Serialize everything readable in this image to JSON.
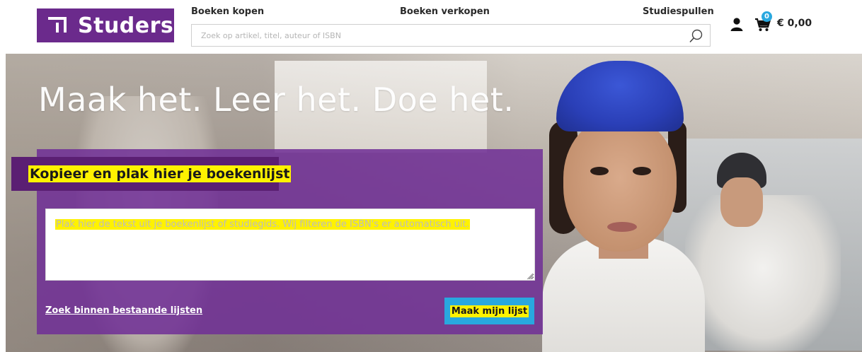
{
  "header": {
    "logo_text": "Studers",
    "nav": {
      "buy_books": "Boeken kopen",
      "sell_books": "Boeken verkopen",
      "study_supplies": "Studiespullen"
    },
    "search": {
      "placeholder": "Zoek op artikel, titel, auteur of ISBN",
      "value": "",
      "icon": "search-icon"
    },
    "account_icon": "user-icon",
    "cart": {
      "icon": "cart-icon",
      "count": "0",
      "total": "€ 0,00"
    }
  },
  "hero": {
    "title": "Maak het. Leer het. Doe het."
  },
  "booklist_panel": {
    "heading": "Kopieer en plak hier je boekenlijst",
    "textarea_placeholder": "Plak hier de tekst uit je boekenlijst of studiegids. Wij filteren de ISBN's er automatisch uit.",
    "existing_lists_link": "Zoek binnen bestaande lijsten",
    "submit_button": "Maak mijn lijst"
  },
  "colors": {
    "brand_purple": "#6b2a8c",
    "panel_purple": "#702e96",
    "accent_blue": "#29a8df",
    "highlight_yellow": "#fff200"
  }
}
